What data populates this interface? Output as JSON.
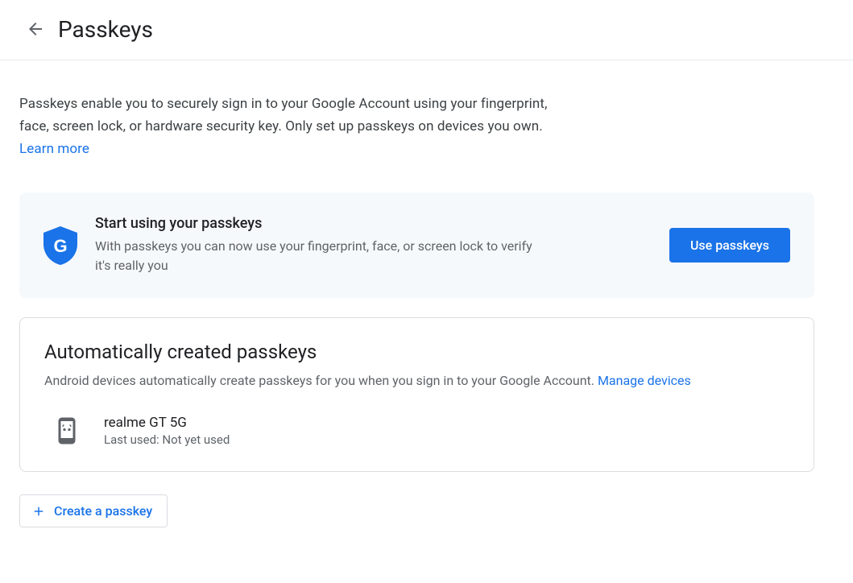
{
  "header": {
    "title": "Passkeys"
  },
  "intro": {
    "text": "Passkeys enable you to securely sign in to your Google Account using your fingerprint, face, screen lock, or hardware security key. Only set up passkeys on devices you own. ",
    "learn_more": "Learn more"
  },
  "promo": {
    "title": "Start using your passkeys",
    "desc": "With passkeys you can now use your fingerprint, face, or screen lock to verify it's really you",
    "button": "Use passkeys"
  },
  "auto": {
    "title": "Automatically created passkeys",
    "desc": "Android devices automatically create passkeys for you when you sign in to your Google Account. ",
    "manage_link": "Manage devices",
    "devices": [
      {
        "name": "realme GT 5G",
        "sub": "Last used: Not yet used"
      }
    ]
  },
  "create_button": "Create a passkey"
}
